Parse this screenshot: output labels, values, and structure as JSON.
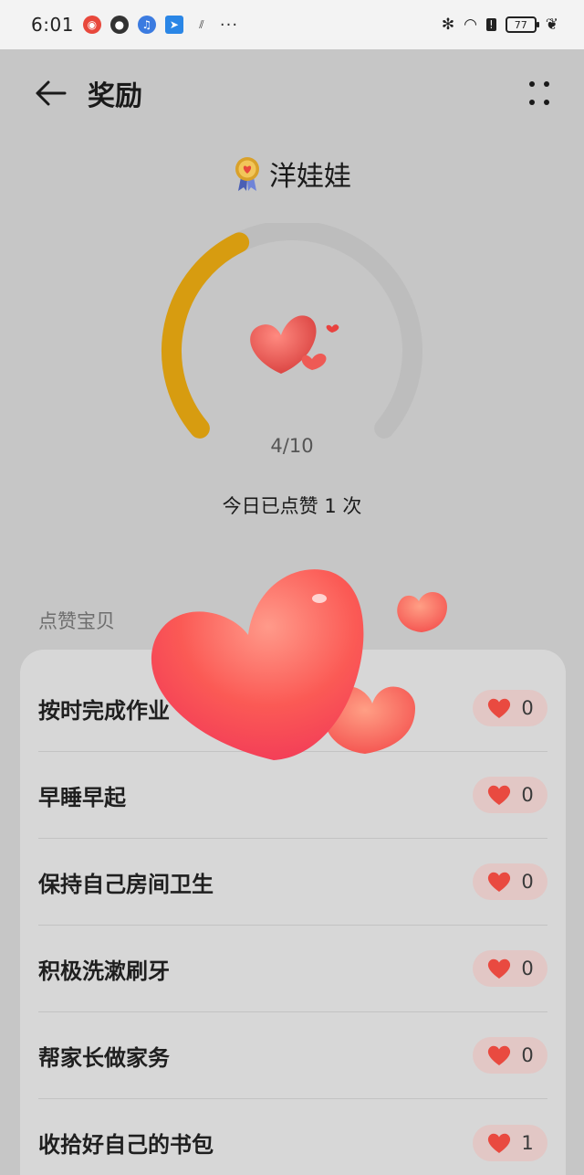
{
  "status_bar": {
    "time": "6:01",
    "overflow": "···",
    "battery": "77",
    "icons": [
      "weibo-icon",
      "basketball-icon",
      "music-icon",
      "location-icon",
      "app-icon",
      "bluetooth-icon",
      "wifi-icon",
      "alert-icon",
      "battery-icon",
      "leaf-icon"
    ]
  },
  "header": {
    "title": "奖励"
  },
  "child": {
    "name": "洋娃娃"
  },
  "progress": {
    "current": 4,
    "total": 10,
    "label": "4/10",
    "fraction": 0.4
  },
  "today": {
    "text": "今日已点赞 1 次"
  },
  "section": {
    "label": "点赞宝贝"
  },
  "tasks": [
    {
      "label": "按时完成作业",
      "count": "0"
    },
    {
      "label": "早睡早起",
      "count": "0"
    },
    {
      "label": "保持自己房间卫生",
      "count": "0"
    },
    {
      "label": "积极洗漱刷牙",
      "count": "0"
    },
    {
      "label": "帮家长做家务",
      "count": "0"
    },
    {
      "label": "收拾好自己的书包",
      "count": "1"
    }
  ],
  "colors": {
    "accent": "#d79c10",
    "track": "#bdbdbd",
    "heart": "#f0524f"
  }
}
